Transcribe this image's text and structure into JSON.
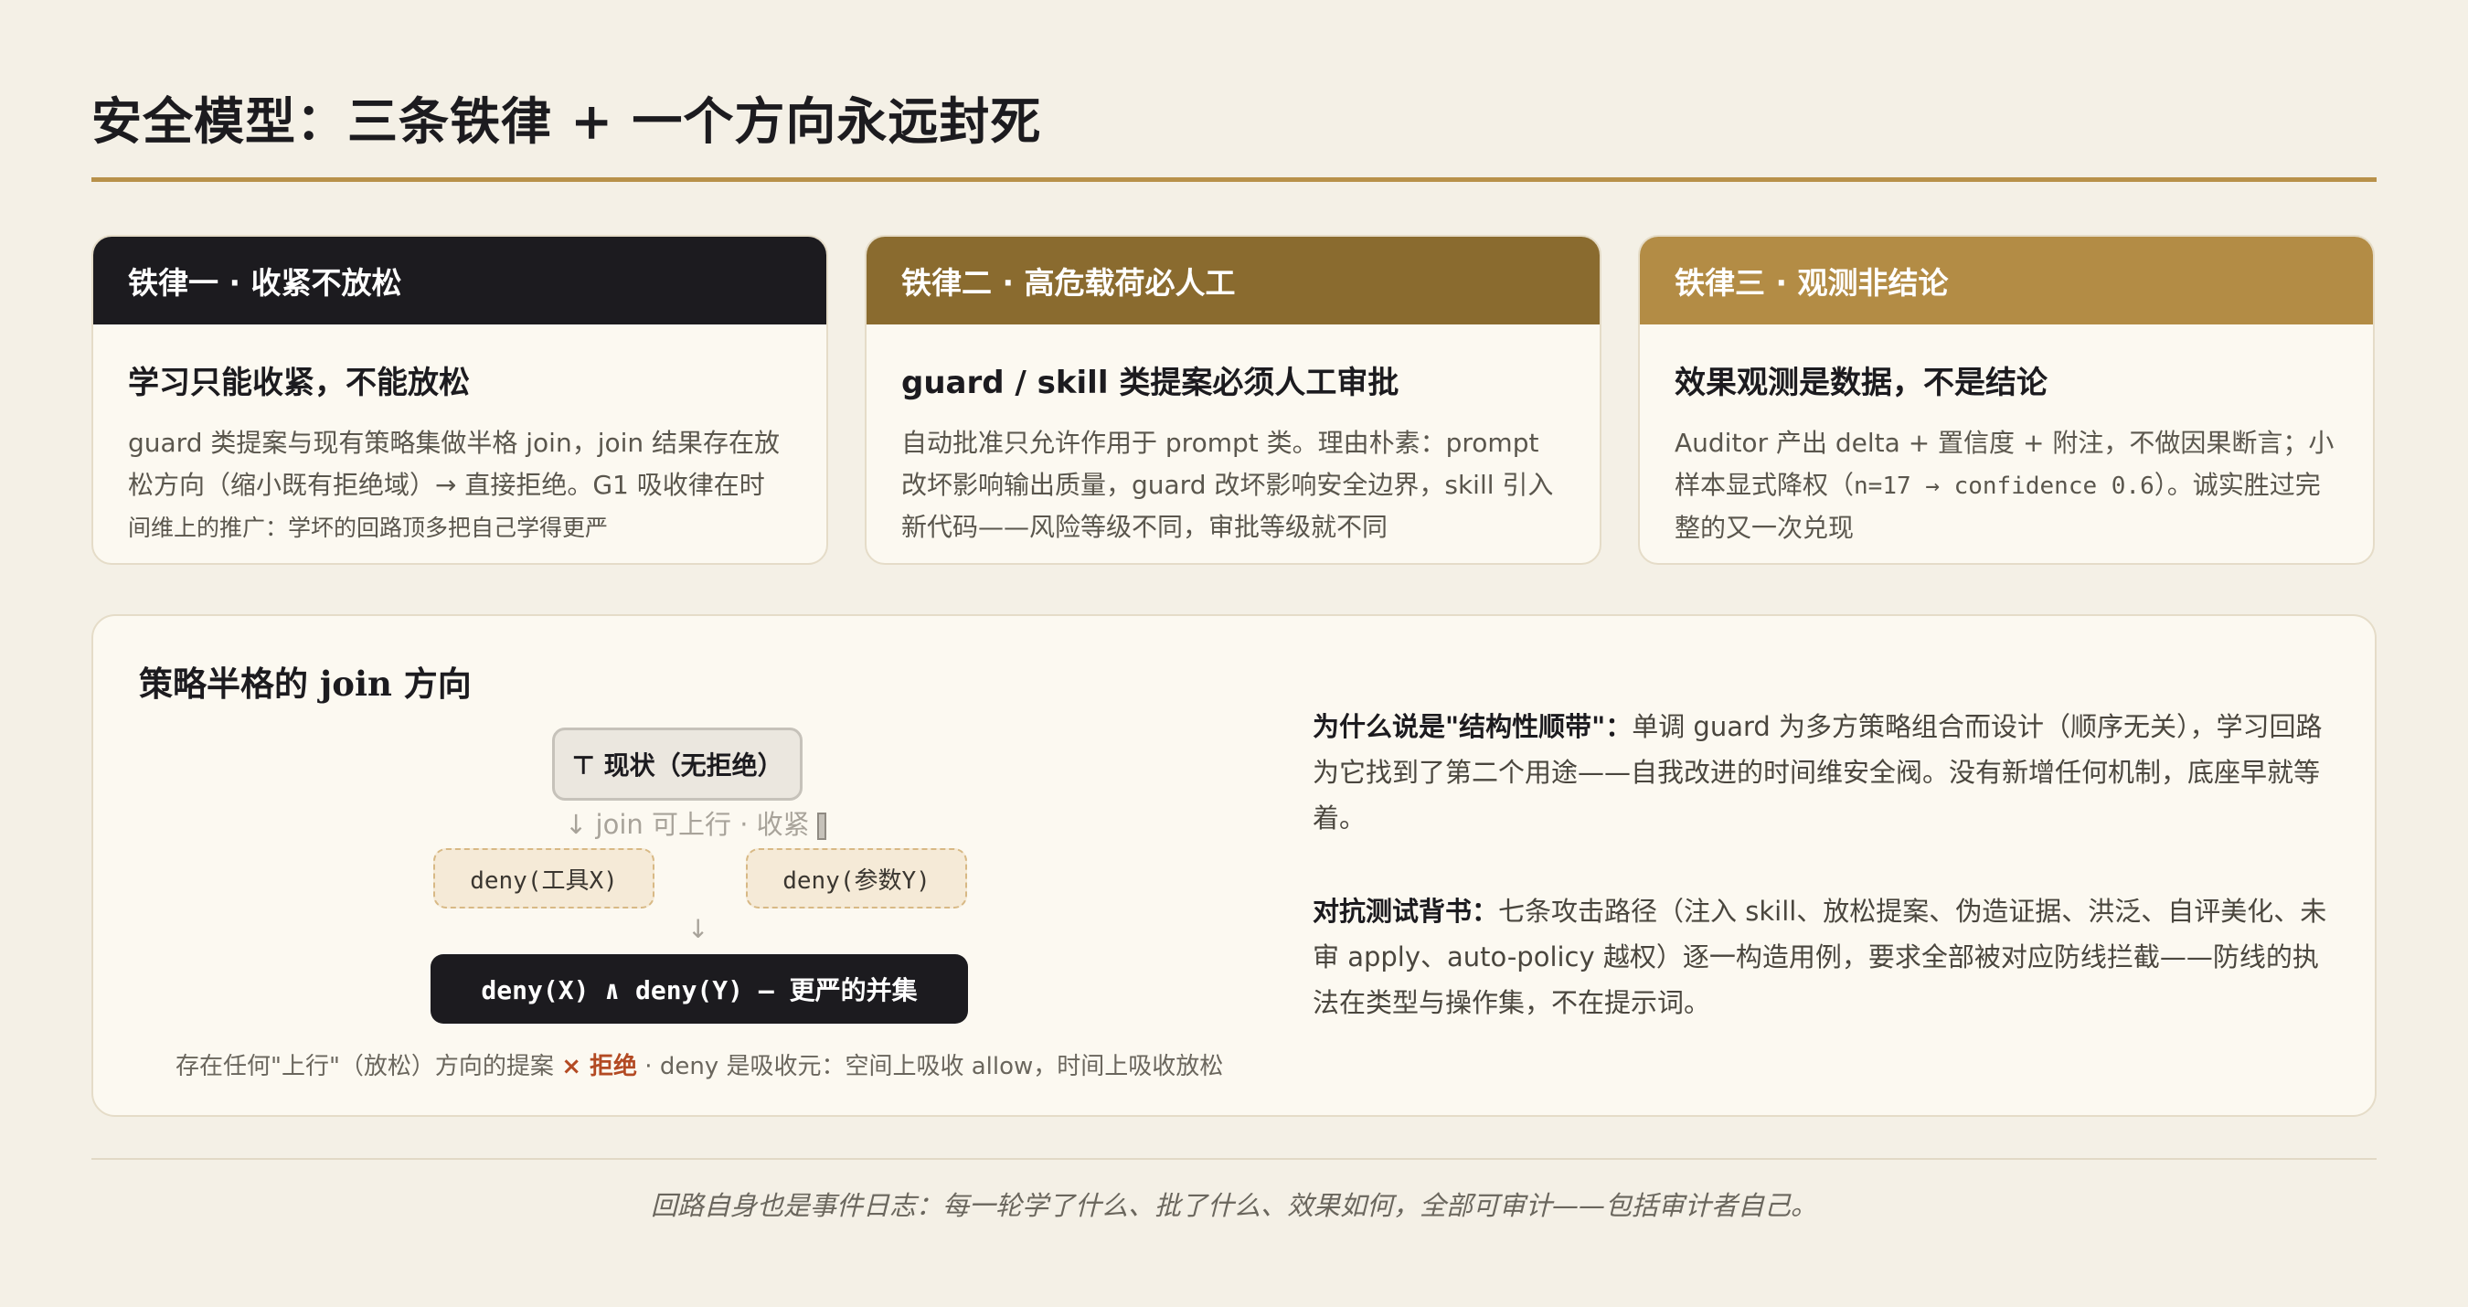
{
  "title": "安全模型：三条铁律 + 一个方向永远封死",
  "cards": [
    {
      "header": "铁律一 · 收紧不放松",
      "header_color": "#1c1b1f",
      "subtitle": "学习只能收紧，不能放松",
      "lines": [
        "guard 类提案与现有策略集做半格 join，join 结果存在放",
        "松方向（缩小既有拒绝域）→ 直接拒绝。G1 吸收律在时",
        "间维上的推广：学坏的回路顶多把自己学得更严"
      ]
    },
    {
      "header": "铁律二 · 高危载荷必人工",
      "header_color": "#8a6b2f",
      "subtitle": "guard / skill 类提案必须人工审批",
      "lines": [
        "自动批准只允许作用于 prompt 类。理由朴素：prompt",
        "改坏影响输出质量，guard 改坏影响安全边界，skill 引入",
        "新代码——风险等级不同，审批等级就不同"
      ]
    },
    {
      "header": "铁律三 · 观测非结论",
      "header_color": "#b38c45",
      "subtitle": "效果观测是数据，不是结论",
      "line1": "Auditor 产出 delta + 置信度 + 附注，不做因果断言；小",
      "line2_pre": "样本显式降权（",
      "line2_code": "n=17 → confidence 0.6",
      "line2_post": "）。诚实胜过完",
      "line3": "整的又一次兑现"
    }
  ],
  "panel": {
    "title": "策略半格的 join 方向",
    "diagram": {
      "top": "⊤ 现状（无拒绝）",
      "edge_label": "↓ join 可上行 · 收紧",
      "left": "deny(工具X)",
      "right": "deny(参数Y)",
      "arrow": "↓",
      "bottom": "deny(X) ∧ deny(Y) — 更严的并集"
    },
    "caption_pre": "存在任何\"上行\"（放松）方向的提案",
    "caption_reject": "× 拒绝",
    "caption_post": " · deny 是吸收元：空间上吸收 allow，时间上吸收放松",
    "p1_bold": "为什么说是\"结构性顺带\"：",
    "p1_text": "单调 guard 为多方策略组合而设计（顺序无关），学习回路为它找到了第二个用途——自我改进的时间维安全阀。没有新增任何机制，底座早就等着。",
    "p2_bold": "对抗测试背书：",
    "p2_text": "七条攻击路径（注入 skill、放松提案、伪造证据、洪泛、自评美化、未审 apply、auto-policy 越权）逐一构造用例，要求全部被对应防线拦截——防线的执法在类型与操作集，不在提示词。"
  },
  "footer": "回路自身也是事件日志：每一轮学了什么、批了什么、效果如何，全部可审计——包括审计者自己。"
}
